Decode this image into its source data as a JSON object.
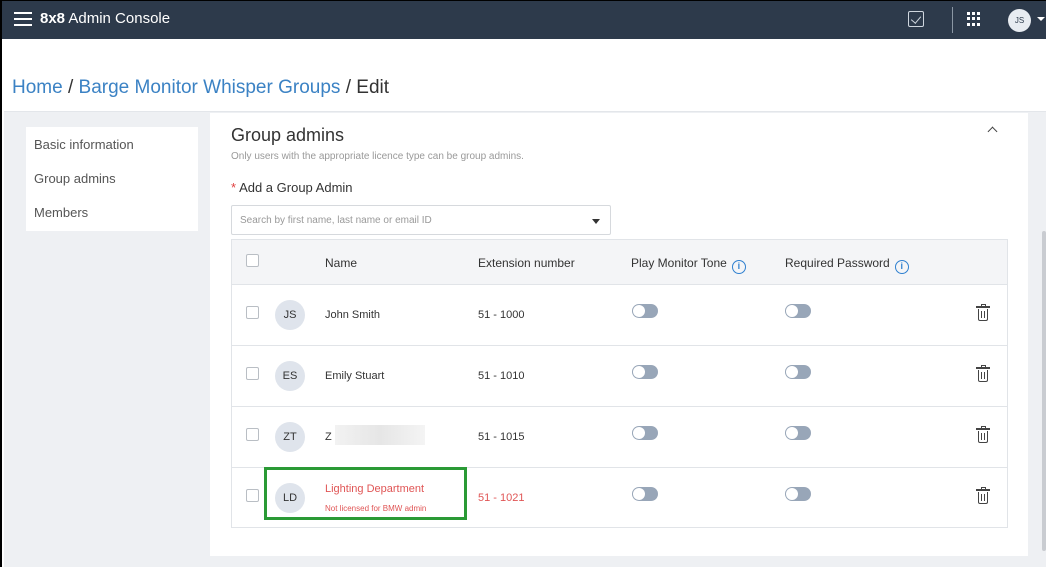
{
  "header": {
    "brand_bold": "8x8",
    "brand_text": "Admin Console",
    "avatar_initials": "JS"
  },
  "breadcrumb": {
    "home": "Home",
    "sep1": " / ",
    "section": "Barge Monitor Whisper Groups",
    "sep2": " / ",
    "current": "Edit"
  },
  "sidebar": {
    "items": [
      {
        "label": "Basic information"
      },
      {
        "label": "Group admins"
      },
      {
        "label": "Members"
      }
    ]
  },
  "group_admins": {
    "title": "Group admins",
    "subtitle": "Only users with the appropriate licence type can be group admins.",
    "add_label": "Add a Group Admin",
    "search_placeholder": "Search by first name, last name or email ID"
  },
  "table": {
    "headers": {
      "name": "Name",
      "extension": "Extension number",
      "monitor_tone": "Play Monitor Tone",
      "password": "Required Password",
      "info": "i"
    },
    "rows": [
      {
        "initials": "JS",
        "name": "John Smith",
        "extension": "51 - 1000",
        "monitor_tone": false,
        "password": false
      },
      {
        "initials": "ES",
        "name": "Emily Stuart",
        "extension": "51 - 1010",
        "monitor_tone": false,
        "password": false
      },
      {
        "initials": "ZT",
        "name": "Z",
        "extension": "51 - 1015",
        "monitor_tone": false,
        "password": false
      },
      {
        "initials": "LD",
        "name": "Lighting Department",
        "note": "Not licensed for BMW admin",
        "extension": "51 - 1021",
        "monitor_tone": false,
        "password": false
      }
    ]
  },
  "colors": {
    "topbar": "#2d3a4b",
    "link": "#3b82c4",
    "error": "#e05555",
    "highlight": "#2a9a35"
  }
}
